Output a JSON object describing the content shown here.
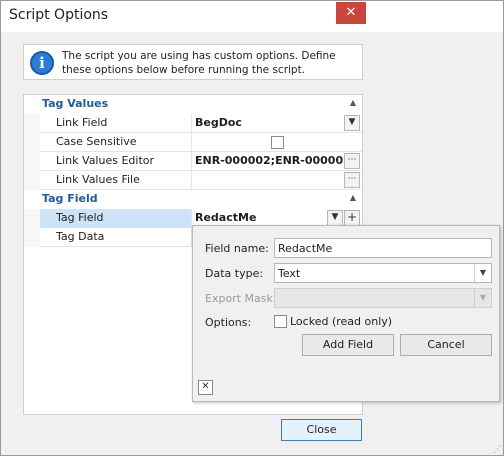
{
  "window": {
    "title": "Script Options",
    "close_glyph": "✕"
  },
  "info": {
    "icon": "info-icon",
    "text": "The script you are using has custom options. Define these options below before running the script."
  },
  "grid": {
    "categories": [
      {
        "label": "Tag Values",
        "collapse_icon": "▲"
      },
      {
        "label": "Tag Field",
        "collapse_icon": "▲"
      }
    ],
    "rows": [
      {
        "name": "Link Field",
        "value": "BegDoc"
      },
      {
        "name": "Case Sensitive",
        "value": ""
      },
      {
        "name": "Link Values Editor",
        "value": "ENR-000002;ENR-00000..."
      },
      {
        "name": "Link Values File",
        "value": ""
      },
      {
        "name": "Tag Field",
        "value": "RedactMe"
      },
      {
        "name": "Tag Data",
        "value": ""
      }
    ],
    "ellipsis": "⋯",
    "dropdown_glyph": "▼",
    "plus_glyph": "+"
  },
  "popup": {
    "field_name_label": "Field name:",
    "field_name_value": "RedactMe",
    "data_type_label": "Data type:",
    "data_type_value": "Text",
    "export_mask_label": "Export Mask:",
    "options_label": "Options:",
    "locked_label": "Locked (read only)",
    "add_field": "Add Field",
    "cancel": "Cancel",
    "close_glyph": "✕"
  },
  "footer": {
    "close": "Close"
  },
  "colors": {
    "accent": "#1f5b9a",
    "selected": "#cde3f7",
    "close_red": "#c9463d"
  }
}
